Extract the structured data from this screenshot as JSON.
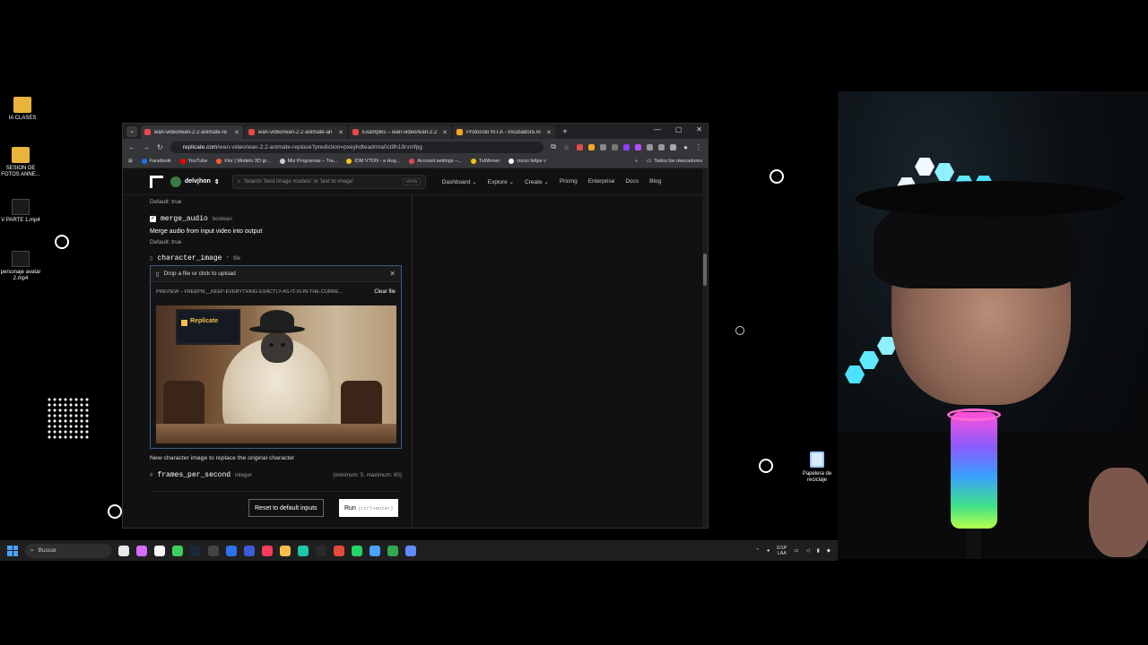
{
  "desktop": {
    "icons": [
      {
        "label": "IA CLASES"
      },
      {
        "label": "SESION DE FOTOS ANNE..."
      },
      {
        "label": "V PARTE 1.mp4"
      },
      {
        "label": "personaje avatar 2.mp4"
      }
    ],
    "recycle_label": "Papelera de reciclaje"
  },
  "browser": {
    "tabs": [
      {
        "title": "wan-video/wan-2.2-animate-re",
        "color": "#e5484d",
        "active": true
      },
      {
        "title": "wan-video/wan-2.2-animate-an",
        "color": "#e5484d",
        "active": false
      },
      {
        "title": "Examples – wan-video/wan-2.2",
        "color": "#e5484d",
        "active": false
      },
      {
        "title": "Protocolo M.I.A - Incubadora Al",
        "color": "#f5a623",
        "active": false
      }
    ],
    "url_host": "replicate.com",
    "url_path": "/wan-video/wan-2.2-animate-replace?prediction=pxeyhdteadrma0ct9h18rxmfpg",
    "bookmarks": [
      {
        "label": "Facebook",
        "color": "#1877f2"
      },
      {
        "label": "YouTube",
        "color": "#ff0000"
      },
      {
        "label": "Flor | Modelo 3D gr...",
        "color": "#ff5a36"
      },
      {
        "label": "Mis Programas – Tra...",
        "color": "#cccccc"
      },
      {
        "label": "IDM VTON - a Hug...",
        "color": "#f5c518"
      },
      {
        "label": "Account settings –...",
        "color": "#e5484d"
      },
      {
        "label": "TuWinner",
        "color": "#f5c518"
      },
      {
        "label": "curso felipe v",
        "color": "#ffffff"
      }
    ],
    "all_bookmarks": "Todos los marcadores"
  },
  "site": {
    "username": "delvjhon",
    "search_placeholder": "Search 'best image models' or 'text to image'",
    "search_shortcut": "ctrl+k",
    "nav": [
      "Dashboard",
      "Explore",
      "Create",
      "Pricing",
      "Enterprise",
      "Docs",
      "Blog"
    ],
    "nav_dropdown_marks": [
      "⌄",
      "⌄",
      "⌄"
    ]
  },
  "form": {
    "prev_default": "Default: true",
    "merge_audio": {
      "name": "merge_audio",
      "type": "boolean",
      "description": "Merge audio from input video into output",
      "default": "Default: true"
    },
    "character_image": {
      "name": "character_image",
      "required_mark": "*",
      "type": "file",
      "drop_text": "Drop a file or click to upload",
      "preview_label": "PREVIEW – FREEPIK__KEEP-EVERYTHING-EXACTLY-AS-IT-IS-IN-THE-CURRE...",
      "clear_label": "Clear file",
      "tv_text": "Replicate",
      "description": "New character image to replace the original character"
    },
    "frames_per_second": {
      "name": "frames_per_second",
      "type": "integer",
      "range": "(minimum: 5, maximum: 60)"
    },
    "reset_label": "Reset to default inputs",
    "run_label": "Run",
    "run_shortcut": "(ctrl+enter)"
  },
  "taskbar": {
    "search_label": "Buscar",
    "lang_top": "ESP",
    "lang_bottom": "LAA"
  }
}
